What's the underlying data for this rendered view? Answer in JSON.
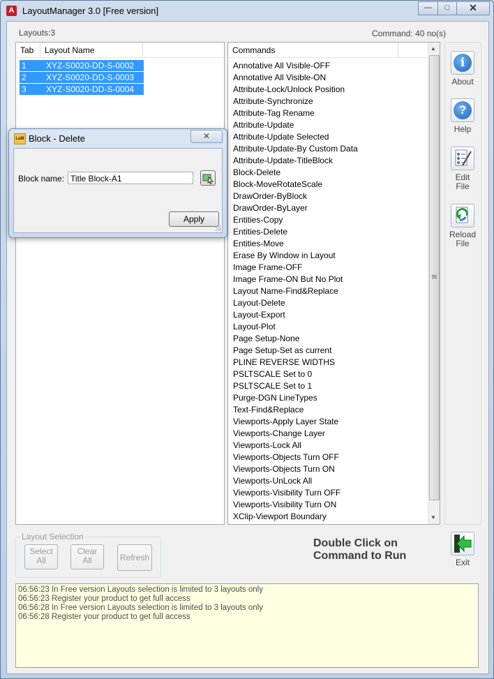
{
  "window": {
    "title": "LayoutManager 3.0 [Free version]",
    "app_icon": "autocad-a-icon"
  },
  "header": {
    "layouts_count": "Layouts:3",
    "command_count": "Command: 40 no(s)"
  },
  "layouts_table": {
    "columns": [
      "Tab",
      "Layout Name"
    ],
    "rows": [
      {
        "tab": "1",
        "name": "XYZ-S0020-DD-S-0002"
      },
      {
        "tab": "2",
        "name": "XYZ-S0020-DD-S-0003"
      },
      {
        "tab": "3",
        "name": "XYZ-S0020-DD-S-0004"
      }
    ]
  },
  "commands_list": {
    "header": "Commands",
    "items": [
      "Annotative All Visible-OFF",
      "Annotative All Visible-ON",
      "Attribute-Lock/Unlock Position",
      "Attribute-Synchronize",
      "Attribute-Tag Rename",
      "Attribute-Update",
      "Attribute-Update Selected",
      "Attribute-Update-By Custom Data",
      "Attribute-Update-TitleBlock",
      "Block-Delete",
      "Block-MoveRotateScale",
      "DrawOrder-ByBlock",
      "DrawOrder-ByLayer",
      "Entities-Copy",
      "Entities-Delete",
      "Entities-Move",
      "Erase By Window in Layout",
      "Image Frame-OFF",
      "Image Frame-ON But No Plot",
      "Layout Name-Find&Replace",
      "Layout-Delete",
      "Layout-Export",
      "Layout-Plot",
      "Page Setup-None",
      "Page Setup-Set as current",
      "PLINE REVERSE WIDTHS",
      "PSLTSCALE Set to 0",
      "PSLTSCALE Set to 1",
      "Purge-DGN LineTypes",
      "Text-Find&Replace",
      "Viewports-Apply Layer State",
      "Viewports-Change Layer",
      "Viewports-Lock All",
      "Viewports-Objects Turn OFF",
      "Viewports-Objects Turn ON",
      "Viewports-UnLock All",
      "Viewports-Visibility Turn OFF",
      "Viewports-Visibility Turn ON",
      "XClip-Viewport Boundary"
    ]
  },
  "side_buttons": {
    "about": {
      "label": "About",
      "icon": "info-icon"
    },
    "help": {
      "label": "Help",
      "icon": "help-icon"
    },
    "edit_file": {
      "label_1": "Edit",
      "label_2": "File",
      "icon": "edit-file-icon"
    },
    "reload_file": {
      "label_1": "Reload",
      "label_2": "File",
      "icon": "reload-file-icon"
    },
    "exit": {
      "label": "Exit",
      "icon": "exit-arrow-icon"
    }
  },
  "layout_selection": {
    "group_label": "Layout Selection",
    "select_all_1": "Select",
    "select_all_2": "All",
    "clear_all_1": "Clear",
    "clear_all_2": "All",
    "refresh": "Refresh"
  },
  "hint": {
    "line1": "Double Click on",
    "line2": "Command to Run"
  },
  "log": {
    "lines": [
      "06:56:23 In Free version Layouts selection is limited to 3 layouts only",
      "06:56:23 Register your product to get full access",
      "06:56:28 In Free version Layouts selection is limited to 3 layouts only",
      "06:56:28 Register your product to get full access"
    ]
  },
  "dialog": {
    "title": "Block - Delete",
    "icon": "lm-app-icon",
    "icon_text": "LaM",
    "block_name_label": "Block name:",
    "block_name_value": "Title Block-A1",
    "pick_icon": "pick-block-icon",
    "apply_label": "Apply",
    "close_icon": "close-icon"
  },
  "colors": {
    "selection": "#3399ff",
    "log_background": "#ffffe1",
    "frame": "#c9d7e8"
  }
}
